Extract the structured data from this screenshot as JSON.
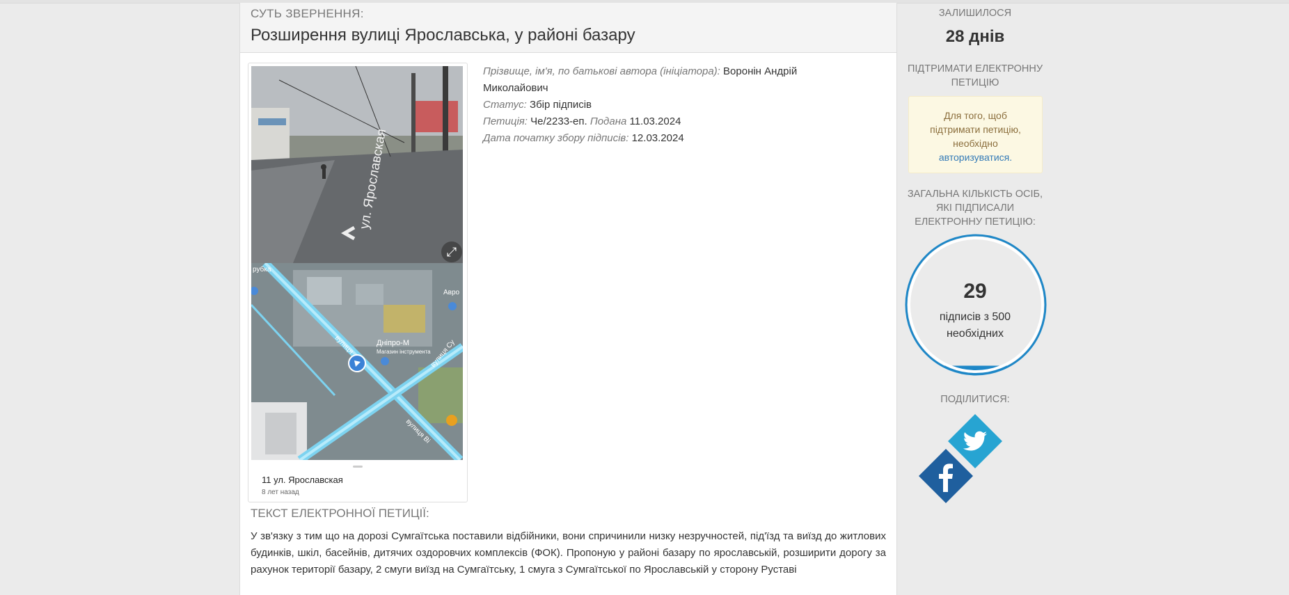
{
  "header": {
    "section_label": "СУТЬ ЗВЕРНЕННЯ:",
    "title": "Розширення вулиці Ярославська, у районі базару"
  },
  "photo": {
    "street_sign": "ул. Ярославская",
    "map_labels": [
      "Дніпро-М",
      "Магазин інструмента",
      "вулиця Су",
      "вулиця Ві",
      "вулиця",
      "Авро",
      "рубка"
    ],
    "place_name": "11 ул. Ярославская",
    "place_time": "8 лет назад"
  },
  "meta": {
    "author_label": "Прізвище, ім'я, по батькові автора (ініціатора):",
    "author_value": "Воронін Андрій Миколайович",
    "status_label": "Статус:",
    "status_value": "Збір підписів",
    "petition_label": "Петиція:",
    "petition_value": "Че/2233-еп.",
    "submitted_label": "Подана",
    "submitted_value": "11.03.2024",
    "start_label": "Дата початку збору підписів:",
    "start_value": "12.03.2024"
  },
  "text_section": {
    "label": "ТЕКСТ ЕЛЕКТРОННОЇ ПЕТИЦІЇ:",
    "body": "У зв'язку з тим що на дорозі Сумгаїтська поставили відбійники, вони спричинили низку незручностей, під'їзд та виїзд до житлових будинків, шкіл, басейнів, дитячих оздоровчих комплексів (ФОК). Пропоную у районі базару по ярославській, розширити дорогу за рахунок території базару, 2 смуги виїзд на Сумгаїтську, 1 смуга з Сумгаїтської по Ярославській у сторону Руставі"
  },
  "sidebar": {
    "remaining_label": "ЗАЛИШИЛОСЯ",
    "remaining_value": "28 днів",
    "support_label": "ПІДТРИМАТИ ЕЛЕКТРОННУ ПЕТИЦІЮ",
    "notice_text": "Для того, щоб підтримати петицію, необхідно",
    "notice_link": "авторизуватися.",
    "total_label": "ЗАГАЛЬНА КІЛЬКІСТЬ ОСІБ, ЯКІ ПІДПИСАЛИ ЕЛЕКТРОННУ ПЕТИЦІЮ:",
    "signatures": "29",
    "signatures_label": "підписів з 500 необхідних",
    "progress_fraction": 0.058,
    "share_label": "ПОДІЛИТИСЯ:",
    "accent_color": "#1e87c7"
  },
  "social": {
    "twitter_color": "#27a4d2",
    "facebook_color": "#1f5f9e",
    "icons": [
      "twitter-icon",
      "facebook-icon"
    ]
  }
}
